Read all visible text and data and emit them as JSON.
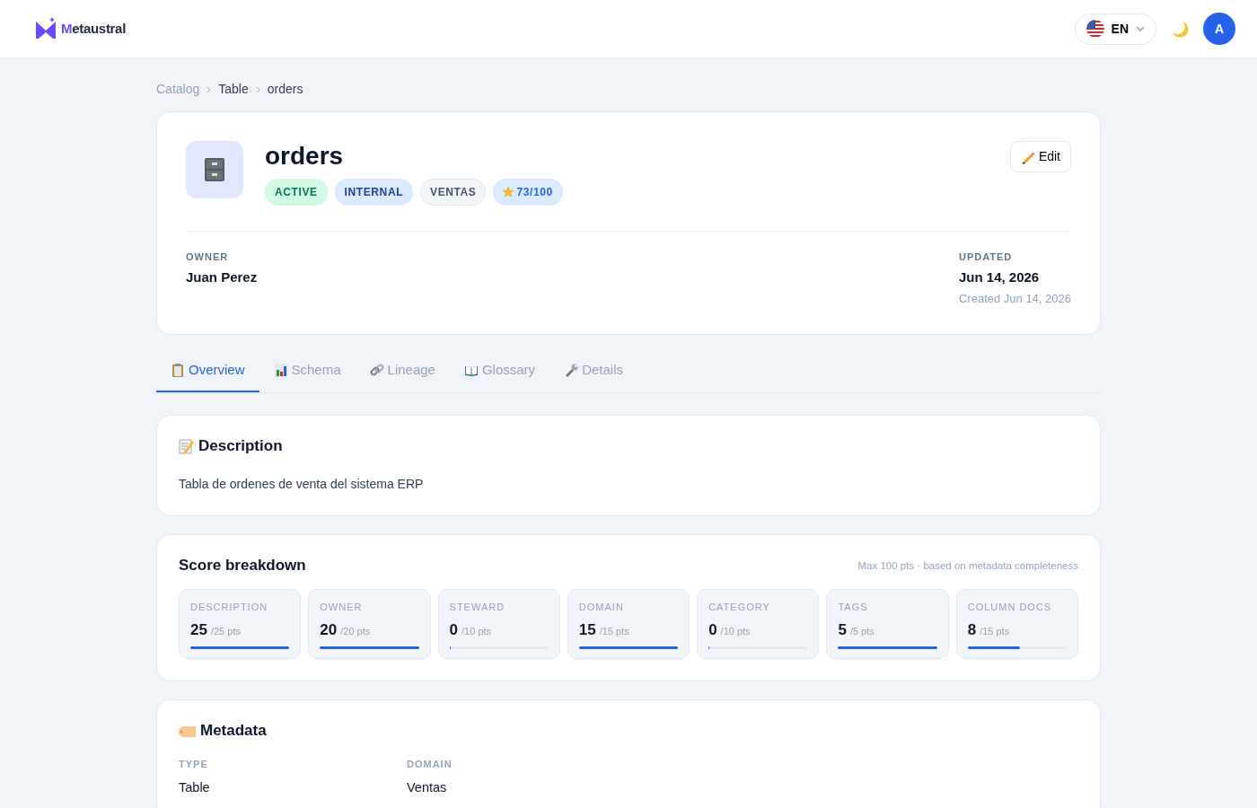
{
  "header": {
    "brand": "Metaustral",
    "language": "EN",
    "avatar": "A"
  },
  "breadcrumb": [
    "Catalog",
    "Table",
    "orders"
  ],
  "asset": {
    "name": "orders",
    "tags": [
      {
        "label": "ACTIVE",
        "kind": "status"
      },
      {
        "label": "INTERNAL",
        "kind": "classification"
      },
      {
        "label": "VENTAS",
        "kind": "domain"
      },
      {
        "label": "73/100",
        "kind": "score"
      }
    ],
    "edit_button": "Edit",
    "owner": {
      "label": "OWNER",
      "value": "Juan Perez"
    },
    "updated": {
      "label": "UPDATED",
      "value": "Jun 14, 2026",
      "note": "Created Jun 14, 2026"
    }
  },
  "tabs": [
    {
      "label": "Overview",
      "selected": true
    },
    {
      "label": "Schema",
      "selected": false
    },
    {
      "label": "Lineage",
      "selected": false
    },
    {
      "label": "Glossary",
      "selected": false
    },
    {
      "label": "Details",
      "selected": false
    }
  ],
  "description": {
    "title": "Description",
    "text": "Tabla de ordenes de venta del sistema ERP"
  },
  "score_breakdown": {
    "title": "Score breakdown",
    "note": "Max 100 pts · based on metadata completeness",
    "items": [
      {
        "label": "DESCRIPTION",
        "score": "25",
        "max": "/25 pts",
        "level": 1
      },
      {
        "label": "OWNER",
        "score": "20",
        "max": "/20 pts",
        "level": 1
      },
      {
        "label": "STEWARD",
        "score": "0",
        "max": "/10 pts",
        "level": 0
      },
      {
        "label": "DOMAIN",
        "score": "15",
        "max": "/15 pts",
        "level": 1
      },
      {
        "label": "CATEGORY",
        "score": "0",
        "max": "/10 pts",
        "level": 0
      },
      {
        "label": "TAGS",
        "score": "5",
        "max": "/5 pts",
        "level": 1
      },
      {
        "label": "COLUMN DOCS",
        "score": "8",
        "max": "/15 pts",
        "level": 0.53
      }
    ]
  },
  "metadata": {
    "title": "Metadata",
    "fields": [
      {
        "label": "TYPE",
        "value": "Table"
      },
      {
        "label": "DOMAIN",
        "value": "Ventas"
      }
    ]
  }
}
